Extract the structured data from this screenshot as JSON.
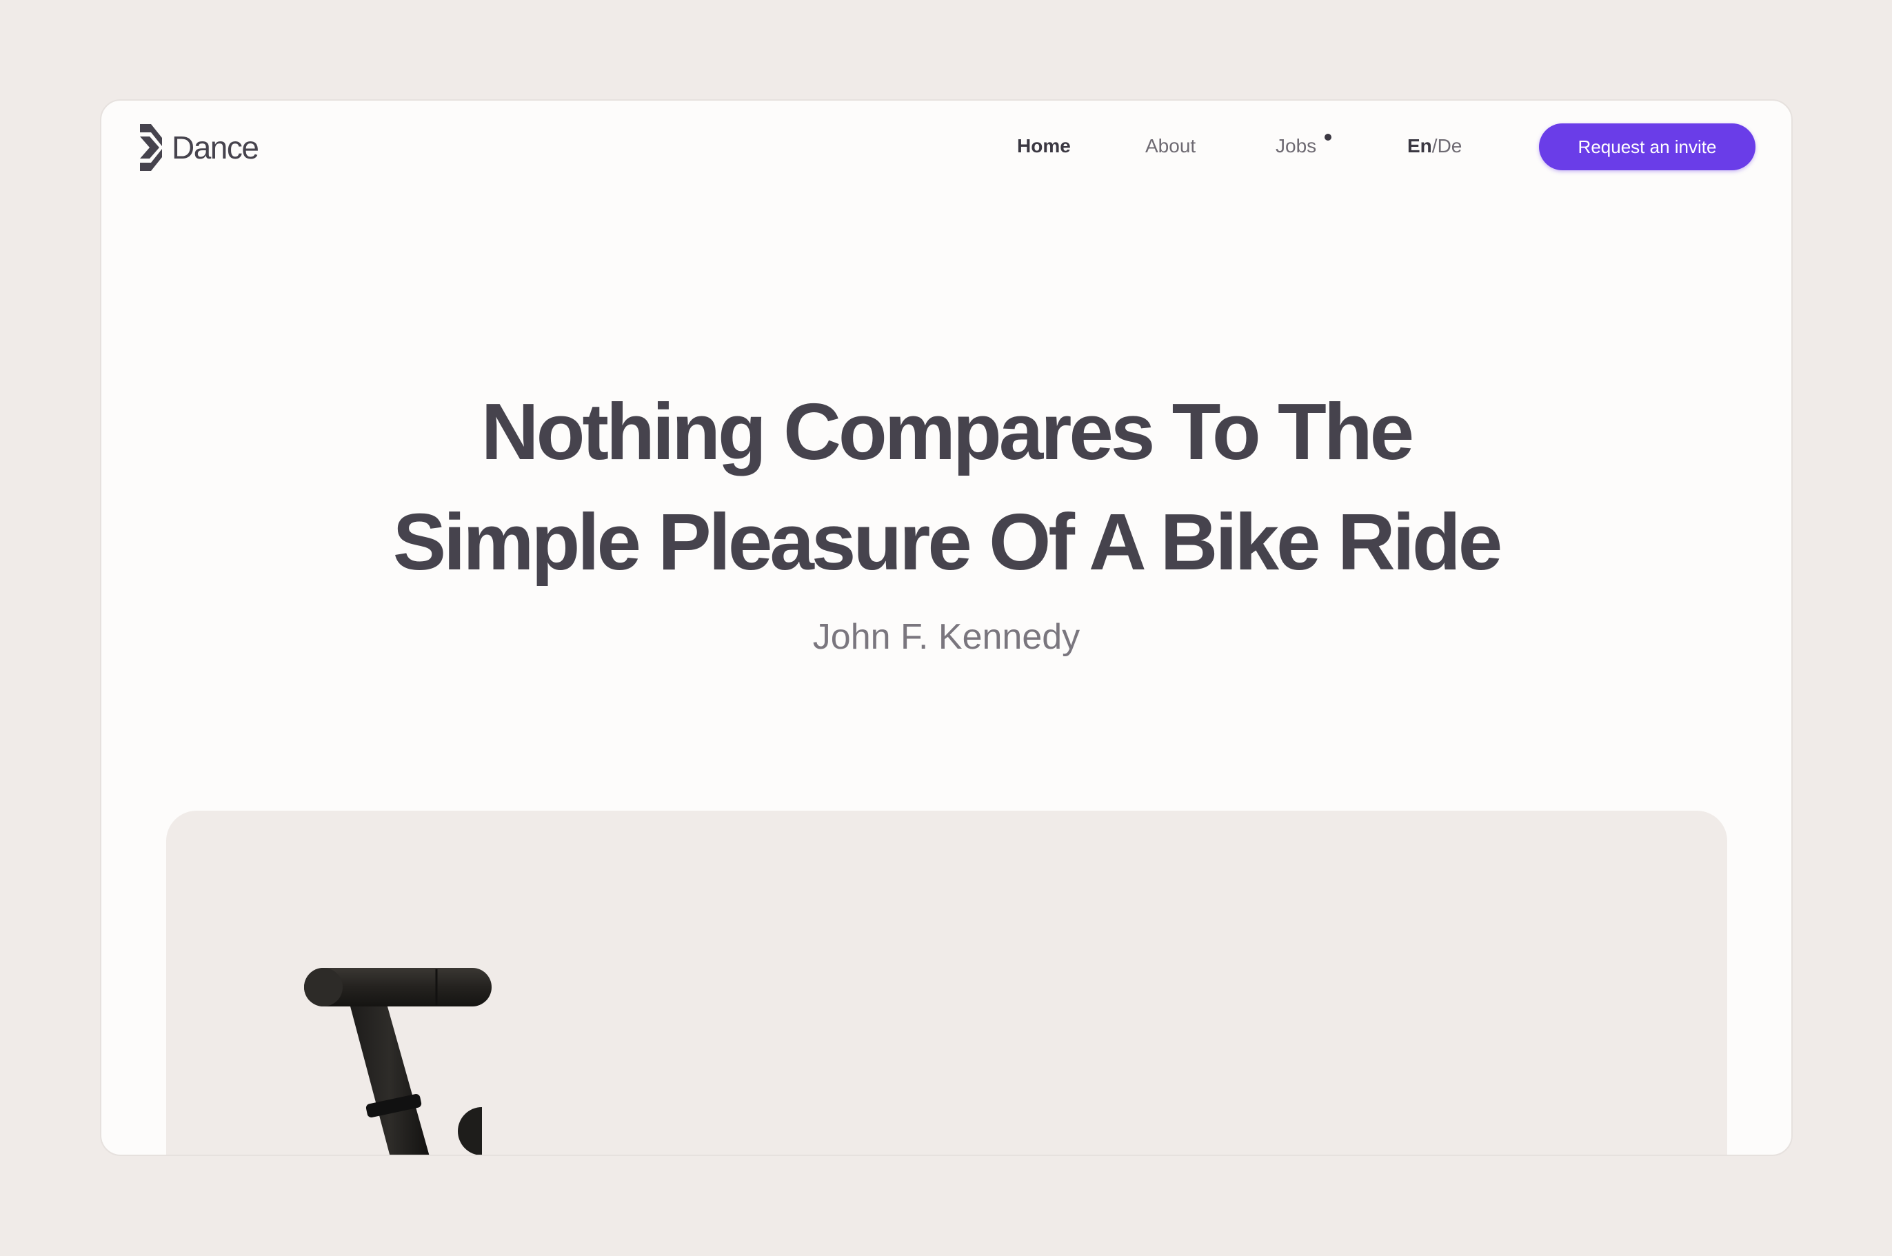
{
  "brand": {
    "name": "Dance",
    "icon": "dance-logo-icon"
  },
  "nav": {
    "items": [
      {
        "label": "Home",
        "active": true
      },
      {
        "label": "About",
        "active": false
      },
      {
        "label": "Jobs",
        "active": false,
        "badge": "notification-dot"
      }
    ],
    "language": {
      "current": "En",
      "separator": "/",
      "other": "De"
    }
  },
  "cta": {
    "label": "Request an invite",
    "color": "#6a3de8"
  },
  "hero": {
    "headline_line1": "Nothing Compares To The",
    "headline_line2": "Simple Pleasure Of A Bike Ride",
    "author": "John F. Kennedy"
  },
  "media": {
    "image": "bike-handlebar-image"
  },
  "colors": {
    "background": "#f0ebe8",
    "surface": "#fdfcfb",
    "text_primary": "#46434d",
    "text_secondary": "#7a767e"
  }
}
